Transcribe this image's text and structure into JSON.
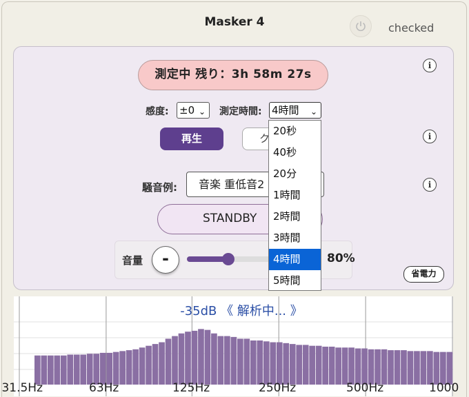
{
  "app": {
    "title": "Masker 4",
    "checked_label": "checked"
  },
  "status": {
    "text": "測定中 残り：3h 58m 27s"
  },
  "controls": {
    "sensitivity_label": "感度:",
    "sensitivity_value": "±0",
    "duration_label": "測定時間:",
    "duration_value": "4時間",
    "play_label": "再生",
    "other_label": "ク",
    "noise_label": "騒音例:",
    "noise_value": "音楽 重低音2",
    "standby_label": "STANDBY",
    "volume_label": "音量",
    "volume_minus": "-",
    "volume_value": "80%",
    "volume_level": 0.46,
    "power_save_label": "省電力",
    "info_glyph": "i"
  },
  "dropdown": {
    "options": [
      "20秒",
      "40秒",
      "20分",
      "1時間",
      "2時間",
      "3時間",
      "4時間",
      "5時間"
    ],
    "selected_index": 6
  },
  "chart_data": {
    "type": "bar",
    "title": "-35dB 《 解析中... 》",
    "x_scale": "log",
    "xlim": [
      31.5,
      1000
    ],
    "x_ticks": [
      "31.5Hz",
      "63Hz",
      "125Hz",
      "250Hz",
      "500Hz",
      "1000"
    ],
    "x_tick_values": [
      31.5,
      63,
      125,
      250,
      500,
      1000
    ],
    "ylim": [
      0,
      1
    ],
    "bar_color": "#8a6fa3",
    "values": [
      0.33,
      0.33,
      0.33,
      0.33,
      0.33,
      0.34,
      0.34,
      0.34,
      0.35,
      0.35,
      0.36,
      0.36,
      0.37,
      0.38,
      0.39,
      0.4,
      0.42,
      0.44,
      0.46,
      0.48,
      0.52,
      0.55,
      0.58,
      0.6,
      0.61,
      0.63,
      0.62,
      0.58,
      0.55,
      0.55,
      0.54,
      0.52,
      0.52,
      0.5,
      0.5,
      0.49,
      0.48,
      0.48,
      0.47,
      0.46,
      0.45,
      0.45,
      0.44,
      0.44,
      0.43,
      0.43,
      0.42,
      0.42,
      0.42,
      0.41,
      0.41,
      0.4,
      0.4,
      0.4,
      0.39,
      0.39,
      0.39,
      0.38,
      0.38,
      0.38,
      0.38,
      0.37,
      0.37,
      0.37
    ]
  }
}
